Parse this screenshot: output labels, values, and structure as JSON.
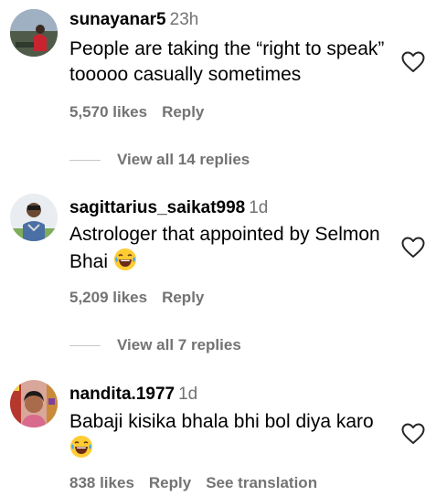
{
  "comments": [
    {
      "username": "sunayanar5",
      "time": "23h",
      "text": "People are taking the “right to speak” tooooo casually sometimes",
      "emoji": "",
      "likes": "5,570 likes",
      "reply_label": "Reply",
      "view_replies": "View all 14 replies"
    },
    {
      "username": "sagittarius_saikat998",
      "time": "1d",
      "text": "Astrologer that appointed by Selmon Bhai",
      "emoji": "laughing-emoji",
      "likes": "5,209 likes",
      "reply_label": "Reply",
      "view_replies": "View all 7 replies"
    },
    {
      "username": "nandita.1977",
      "time": "1d",
      "text": "Babaji kisika bhala bhi bol diya karo",
      "emoji": "laughing-emoji",
      "likes": "838 likes",
      "reply_label": "Reply",
      "see_translation": "See translation"
    }
  ],
  "icons": {
    "like": "heart-outline-icon"
  },
  "colors": {
    "secondary_text": "#737373",
    "primary_text": "#000000",
    "divider": "#c7c7c7"
  }
}
